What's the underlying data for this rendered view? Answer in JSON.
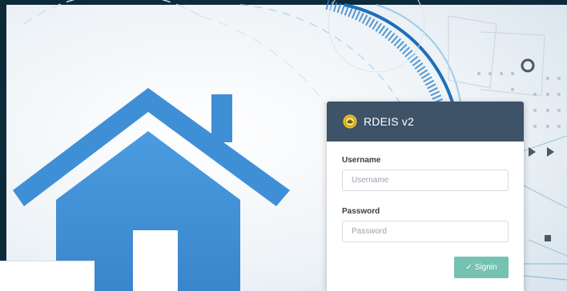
{
  "app": {
    "brand": "RDEIS v2",
    "logo_icon": "seal-logo-icon"
  },
  "form": {
    "username_label": "Username",
    "username_placeholder": "Username",
    "username_value": "",
    "password_label": "Password",
    "password_placeholder": "Password",
    "password_value": "",
    "signin_label": "Signin",
    "signin_icon": "check-icon"
  },
  "colors": {
    "header_bg": "#3e5268",
    "signin_bg": "#75c2b3",
    "house_blue": "#3f8fd6",
    "frame_dark": "#0d2a3a"
  }
}
